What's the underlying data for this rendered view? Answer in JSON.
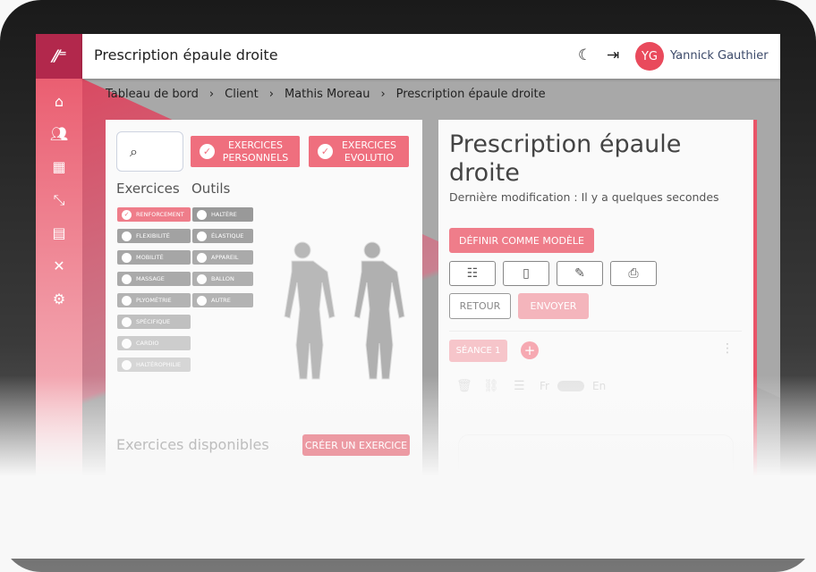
{
  "header": {
    "title": "Prescription épaule droite",
    "user_initials": "YG",
    "user_name": "Yannick Gauthier",
    "theme_icon": "moon-icon",
    "logout_icon": "logout-icon"
  },
  "sidebar": {
    "logo": "logo",
    "items": [
      {
        "icon": "home-icon"
      },
      {
        "icon": "users-icon"
      },
      {
        "icon": "calendar-icon"
      },
      {
        "icon": "dumbbell-icon"
      },
      {
        "icon": "message-icon"
      },
      {
        "icon": "tools-icon"
      },
      {
        "icon": "settings-icon"
      }
    ]
  },
  "breadcrumb": [
    "Tableau de bord",
    "Client",
    "Mathis Moreau",
    "Prescription épaule droite"
  ],
  "left": {
    "filters": [
      {
        "label": "EXERCICES PERSONNELS",
        "checked": true
      },
      {
        "label": "EXERCICES EVOLUTIO",
        "checked": true
      }
    ],
    "exercices_title": "Exercices",
    "outils_title": "Outils",
    "exercices": [
      {
        "label": "RENFORCEMENT",
        "checked": true
      },
      {
        "label": "FLEXIBILITÉ",
        "checked": false
      },
      {
        "label": "MOBILITÉ",
        "checked": false
      },
      {
        "label": "MASSAGE",
        "checked": false
      },
      {
        "label": "PLYOMÉTRIE",
        "checked": false
      },
      {
        "label": "SPÉCIFIQUE",
        "checked": false
      },
      {
        "label": "CARDIO",
        "checked": false
      },
      {
        "label": "HALTÉROPHILIE",
        "checked": false
      }
    ],
    "outils": [
      {
        "label": "HALTÈRE"
      },
      {
        "label": "ÉLASTIQUE"
      },
      {
        "label": "APPAREIL"
      },
      {
        "label": "BALLON"
      },
      {
        "label": "AUTRE"
      }
    ],
    "available_title": "Exercices disponibles",
    "create_button": "CRÉER UN EXERCICE"
  },
  "right": {
    "title": "Prescription épaule droite",
    "subtitle": "Dernière modification : Il y a quelques secondes",
    "template_button": "DÉFINIR COMME MODÈLE",
    "back_button": "RETOUR",
    "send_button": "ENVOYER",
    "session_tab": "SÉANCE 1",
    "lang_fr": "Fr",
    "lang_en": "En"
  },
  "colors": {
    "accent": "#ef6f7e",
    "brand_dark": "#b2284c"
  }
}
